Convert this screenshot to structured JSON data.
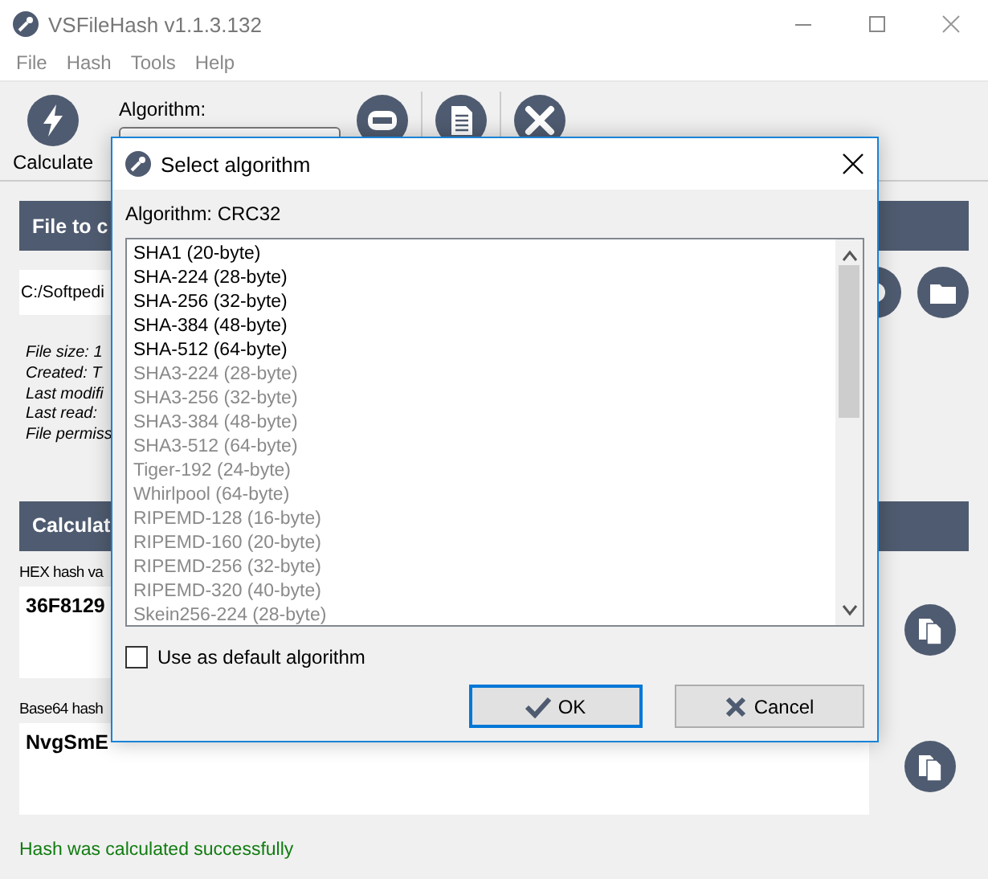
{
  "window": {
    "title": "VSFileHash v1.1.3.132"
  },
  "menu": [
    "File",
    "Hash",
    "Tools",
    "Help"
  ],
  "toolbar": {
    "calculate_label": "Calculate",
    "algorithm_label": "Algorithm:"
  },
  "file_section": {
    "header": "File to c",
    "path": "C:/Softpedi",
    "info": [
      "File size: 1",
      "Created: T",
      "Last modifi",
      "Last read:",
      "File permiss"
    ]
  },
  "calc_section": {
    "header": "Calculat",
    "hex_label": "HEX hash va",
    "hex_value": "36F8129",
    "base64_label": "Base64 hash",
    "base64_value": "NvgSmE"
  },
  "status": "Hash was calculated successfully",
  "dialog": {
    "title": "Select algorithm",
    "current": "Algorithm: CRC32",
    "algorithms": [
      {
        "name": "SHA1 (20-byte)",
        "disabled": false
      },
      {
        "name": "SHA-224 (28-byte)",
        "disabled": false
      },
      {
        "name": "SHA-256 (32-byte)",
        "disabled": false
      },
      {
        "name": "SHA-384 (48-byte)",
        "disabled": false
      },
      {
        "name": "SHA-512 (64-byte)",
        "disabled": false
      },
      {
        "name": "SHA3-224 (28-byte)",
        "disabled": true
      },
      {
        "name": "SHA3-256 (32-byte)",
        "disabled": true
      },
      {
        "name": "SHA3-384 (48-byte)",
        "disabled": true
      },
      {
        "name": "SHA3-512 (64-byte)",
        "disabled": true
      },
      {
        "name": "Tiger-192 (24-byte)",
        "disabled": true
      },
      {
        "name": "Whirlpool (64-byte)",
        "disabled": true
      },
      {
        "name": "RIPEMD-128 (16-byte)",
        "disabled": true
      },
      {
        "name": "RIPEMD-160 (20-byte)",
        "disabled": true
      },
      {
        "name": "RIPEMD-256 (32-byte)",
        "disabled": true
      },
      {
        "name": "RIPEMD-320 (40-byte)",
        "disabled": true
      },
      {
        "name": "Skein256-224 (28-byte)",
        "disabled": true
      }
    ],
    "default_checkbox": {
      "label": "Use as default algorithm",
      "checked": false
    },
    "buttons": [
      {
        "label": "OK",
        "kind": "ok",
        "default": true
      },
      {
        "label": "Cancel",
        "kind": "cancel",
        "default": false
      }
    ]
  }
}
